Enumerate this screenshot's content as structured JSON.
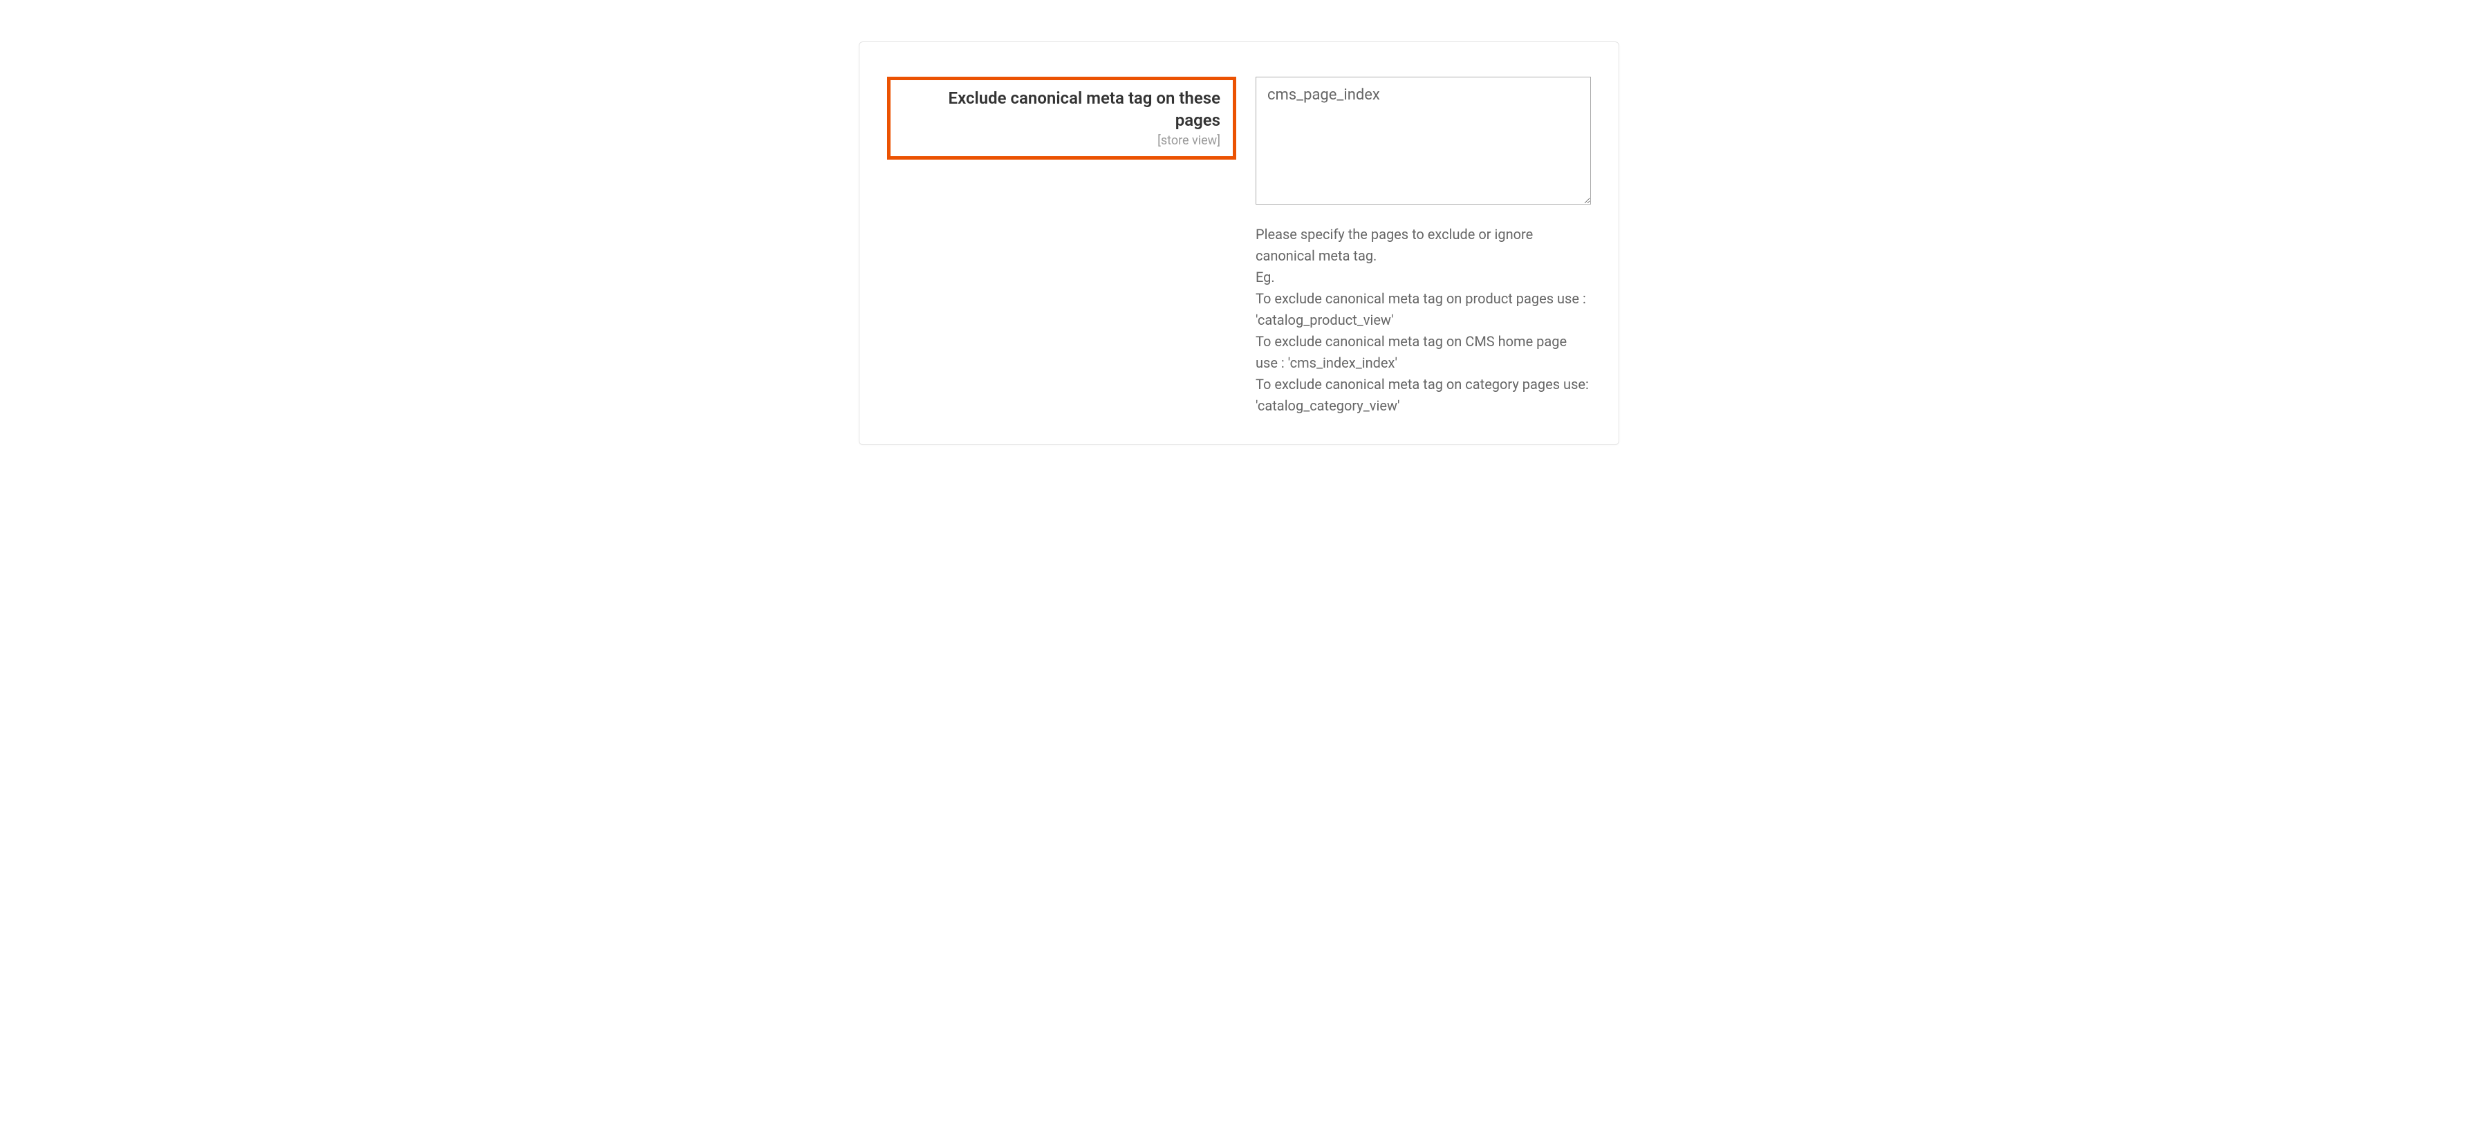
{
  "field": {
    "label": "Exclude canonical meta tag on these pages",
    "scope": "[store view]",
    "value": "cms_page_index",
    "help": "Please specify the pages to exclude or ignore canonical meta tag.\nEg.\nTo exclude canonical meta tag on product pages use : 'catalog_product_view'\nTo exclude canonical meta tag on CMS home page use : 'cms_index_index'\nTo exclude canonical meta tag on category pages use: 'catalog_category_view'"
  },
  "colors": {
    "highlight_border": "#eb5202",
    "text_primary": "#333333",
    "text_secondary": "#666666",
    "text_muted": "#999999",
    "border": "#e3e3e3",
    "input_border": "#adadad"
  }
}
